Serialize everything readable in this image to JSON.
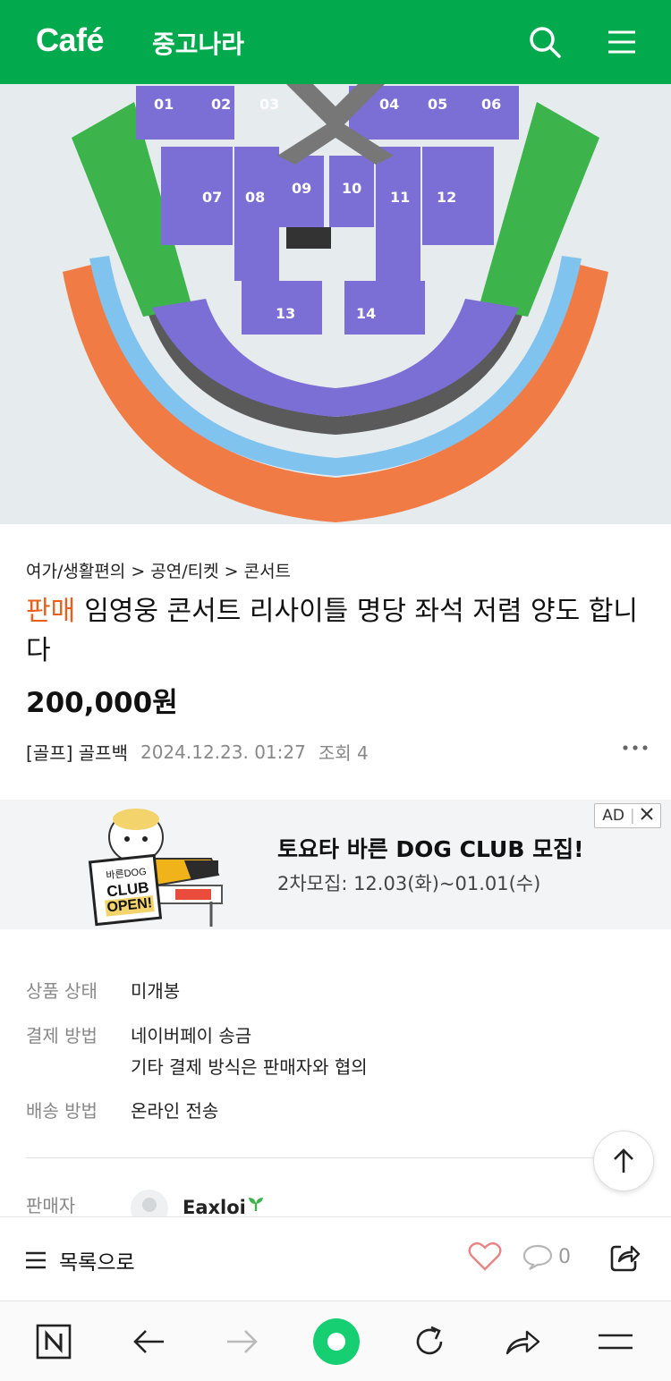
{
  "header": {
    "logo": "Café",
    "cafe_name": "중고나라",
    "color": "#03a94d"
  },
  "seatmap": {
    "sections_top": [
      "01",
      "02",
      "03",
      "04",
      "05",
      "06"
    ],
    "sections_mid": [
      "07",
      "08",
      "09",
      "10",
      "11",
      "12"
    ],
    "sections_floor": [
      "13",
      "14"
    ]
  },
  "post": {
    "breadcrumb": "여가/생활편의 > 공연/티켓 > 콘서트",
    "sale_tag": "판매",
    "title": "임영웅 콘서트 리사이틀 명당 좌석 저렴 양도 합니다",
    "price": "200,000원",
    "author": "[골프] 골프백",
    "date": "2024.12.23. 01:27",
    "views": "조회 4"
  },
  "ad": {
    "badge": "AD",
    "title": "토요타 바른 DOG CLUB 모집!",
    "subtitle": "2차모집: 12.03(화)~01.01(수)",
    "sign_line1": "바른DOG",
    "sign_line2": "CLUB",
    "sign_line3": "OPEN!"
  },
  "info": {
    "condition_label": "상품 상태",
    "condition_value": "미개봉",
    "payment_label": "결제 방법",
    "payment_value1": "네이버페이 송금",
    "payment_value2": "기타 결제 방식은 판매자와 협의",
    "delivery_label": "배송 방법",
    "delivery_value": "온라인 전송",
    "seller_label": "판매자",
    "seller_name": "Eaxloi"
  },
  "bottombar": {
    "list_label": "목록으로",
    "comment_count": "0"
  },
  "colors": {
    "accent": "#03a94d",
    "sale": "#e8601c",
    "seat_purple": "#7b6fd6",
    "seat_green": "#3cb44b",
    "seat_orange": "#f07b45",
    "seat_blue": "#5fb0e8"
  }
}
